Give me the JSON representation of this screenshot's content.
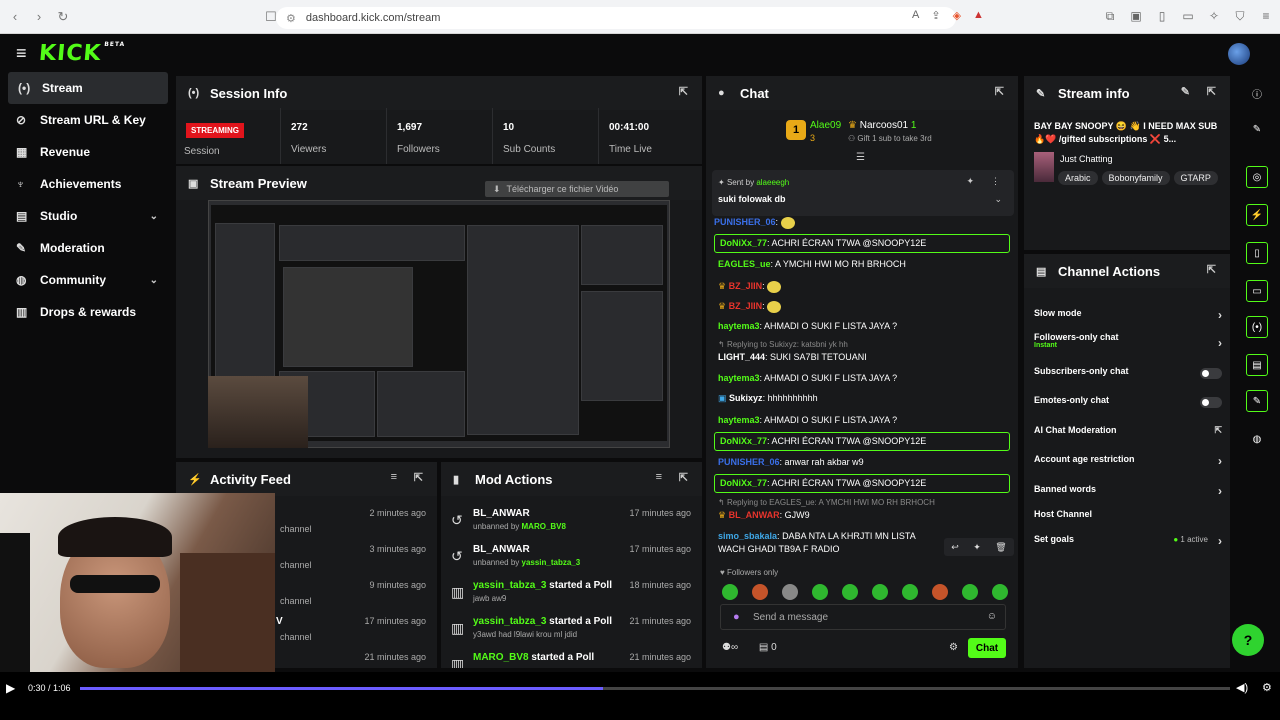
{
  "browser": {
    "url": "dashboard.kick.com/stream"
  },
  "brand": {
    "logo": "KICK",
    "beta": "BETA"
  },
  "sidebar": {
    "items": [
      {
        "label": "Stream",
        "icon": "broadcast-icon",
        "active": true
      },
      {
        "label": "Stream URL & Key",
        "icon": "link-icon"
      },
      {
        "label": "Revenue",
        "icon": "revenue-icon"
      },
      {
        "label": "Achievements",
        "icon": "trophy-icon"
      },
      {
        "label": "Studio",
        "icon": "studio-icon",
        "expandable": true
      },
      {
        "label": "Moderation",
        "icon": "wrench-icon"
      },
      {
        "label": "Community",
        "icon": "community-icon",
        "expandable": true
      },
      {
        "label": "Drops & rewards",
        "icon": "gift-icon"
      }
    ]
  },
  "session": {
    "title": "Session Info",
    "badge": "STREAMING",
    "session_label": "Session",
    "stats": [
      {
        "value": "272",
        "label": "Viewers"
      },
      {
        "value": "1,697",
        "label": "Followers"
      },
      {
        "value": "10",
        "label": "Sub Counts"
      },
      {
        "value": "00:41:00",
        "label": "Time Live"
      }
    ]
  },
  "preview": {
    "title": "Stream Preview",
    "download_text": "Télécharger ce fichier Vidéo"
  },
  "activity": {
    "title": "Activity Feed",
    "rows": [
      {
        "time": "2 minutes ago",
        "text": "channel"
      },
      {
        "time": "3 minutes ago",
        "text": "channel"
      },
      {
        "time": "9 minutes ago",
        "text": "channel"
      },
      {
        "time": "17 minutes ago",
        "text": "channel",
        "prefix": "V"
      },
      {
        "time": "21 minutes ago",
        "text": ""
      }
    ]
  },
  "mod": {
    "title": "Mod Actions",
    "rows": [
      {
        "name": "BL_ANWAR",
        "action": "unbanned by",
        "by": "MARO_BV8",
        "time": "17 minutes ago",
        "icon": "unban-icon",
        "green": false
      },
      {
        "name": "BL_ANWAR",
        "action": "unbanned by",
        "by": "yassin_tabza_3",
        "time": "17 minutes ago",
        "icon": "unban-icon",
        "green": false
      },
      {
        "name": "yassin_tabza_3",
        "action_title": "started a Poll",
        "sub": "jawb aw9",
        "time": "18 minutes ago",
        "icon": "poll-icon",
        "green": true
      },
      {
        "name": "yassin_tabza_3",
        "action_title": "started a Poll",
        "sub": "y3awd had l9lawi krou ml jdid",
        "time": "21 minutes ago",
        "icon": "poll-icon",
        "green": true
      },
      {
        "name": "MARO_BV8",
        "action_title": "started a Poll",
        "sub": "",
        "time": "21 minutes ago",
        "icon": "poll-icon",
        "green": true
      }
    ]
  },
  "chat": {
    "title": "Chat",
    "leader1": {
      "name": "Alae09",
      "count": "3"
    },
    "leader2": {
      "name": "Narcoos01",
      "count": "1"
    },
    "gift_text": "Gift 1 sub to take 3rd",
    "pinned": {
      "sent_by": "Sent by",
      "user": "alaeeegh",
      "text": "suki folowak db"
    },
    "messages": [
      {
        "user": "PUNISHER_06",
        "color": "#3a6fe8",
        "text": "",
        "boxed": false
      },
      {
        "user": "DoNiXx_77",
        "color": "#53fc18",
        "text": "ACHRI ÉCRAN T7WA @SNOOPY12E",
        "boxed": true
      },
      {
        "user": "EAGLES_ue",
        "color": "#53fc18",
        "text": "A YMCHI HWI MO RH BRHOCH",
        "boxed": false
      },
      {
        "user": "BZ_JIIN",
        "color": "#e8342c",
        "text": "",
        "boxed": false
      },
      {
        "user": "BZ_JIIN",
        "color": "#e8342c",
        "text": "",
        "boxed": false
      },
      {
        "user": "haytema3",
        "color": "#53fc18",
        "text": "AHMADI O SUKI F LISTA JAYA ?",
        "boxed": false
      },
      {
        "user": "LIGHT_444",
        "color": "#ffffff",
        "text": "SUKI SA7BI TETOUANI",
        "reply": "Replying to Sukixyz: katsbni yk hh",
        "boxed": false
      },
      {
        "user": "haytema3",
        "color": "#53fc18",
        "text": "AHMADI O SUKI F LISTA JAYA ?",
        "boxed": false
      },
      {
        "user": "Sukixyz",
        "color": "#ffffff",
        "text": "hhhhhhhhhh",
        "boxed": false
      },
      {
        "user": "haytema3",
        "color": "#53fc18",
        "text": "AHMADI O SUKI F LISTA JAYA ?",
        "boxed": false
      },
      {
        "user": "DoNiXx_77",
        "color": "#53fc18",
        "text": "ACHRI ÉCRAN T7WA @SNOOPY12E",
        "boxed": true
      },
      {
        "user": "PUNISHER_06",
        "color": "#3a6fe8",
        "text": "anwar rah akbar w9",
        "boxed": false
      },
      {
        "user": "DoNiXx_77",
        "color": "#53fc18",
        "text": "ACHRI ÉCRAN T7WA @SNOOPY12E",
        "boxed": true
      },
      {
        "user": "BL_ANWAR",
        "color": "#e8342c",
        "text": "GJW9",
        "reply": "Replying to EAGLES_ue: A YMCHI HWI MO RH BRHOCH",
        "boxed": false
      },
      {
        "user": "simo_sbakala",
        "color": "#3fa8e8",
        "text": "DABA NTA LA KHRJTI MN LISTA WACH GHADI TB9A F RADIO",
        "boxed": false
      }
    ],
    "followers_only": "Followers only",
    "placeholder": "Send a message",
    "footer_count": "0",
    "send_label": "Chat"
  },
  "stream_info": {
    "title": "Stream info",
    "stream_title": "BAY BAY SNOOPY 😆 👋 I NEED MAX SUB 🔥❤️ /gifted subscriptions ❌ 5...",
    "category": "Just Chatting",
    "tags": [
      "Arabic",
      "Bobonyfamily",
      "GTARP"
    ]
  },
  "channel_actions": {
    "title": "Channel Actions",
    "rows": [
      {
        "label": "Slow mode",
        "kind": "arrow"
      },
      {
        "label": "Followers-only chat",
        "sub": "Instant",
        "kind": "arrow"
      },
      {
        "label": "Subscribers-only chat",
        "kind": "toggle"
      },
      {
        "label": "Emotes-only chat",
        "kind": "toggle"
      },
      {
        "label": "AI Chat Moderation",
        "kind": "external"
      },
      {
        "label": "Account age restriction",
        "kind": "arrow"
      },
      {
        "label": "Banned words",
        "kind": "arrow"
      },
      {
        "label": "Host Channel",
        "kind": "none"
      },
      {
        "label": "Set goals",
        "kind": "arrow",
        "badge": "1 active"
      }
    ]
  },
  "video": {
    "time": "0:30 / 1:06",
    "progress": 0.455
  }
}
